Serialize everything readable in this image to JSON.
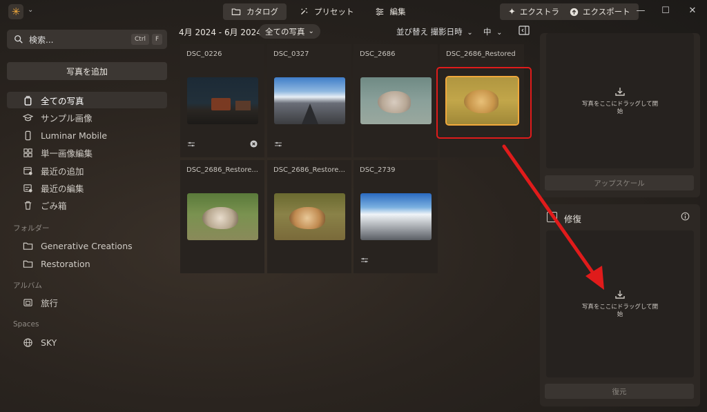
{
  "topbar": {
    "nav": [
      {
        "label": "カタログ",
        "icon": "folder-icon",
        "active": true
      },
      {
        "label": "プリセット",
        "icon": "magic-wand-icon",
        "active": false
      },
      {
        "label": "編集",
        "icon": "sliders-icon",
        "active": false
      }
    ],
    "extra_label": "エクストラ",
    "export_label": "エクスポート"
  },
  "sidebar": {
    "search_placeholder": "検索...",
    "shortcut_ctrl": "Ctrl",
    "shortcut_key": "F",
    "add_photos_label": "写真を追加",
    "items": [
      {
        "label": "全ての写真",
        "icon": "all-photos-icon",
        "active": true
      },
      {
        "label": "サンプル画像",
        "icon": "graduation-cap-icon"
      },
      {
        "label": "Luminar Mobile",
        "icon": "mobile-icon"
      },
      {
        "label": "単一画像編集",
        "icon": "grid-icon"
      },
      {
        "label": "最近の追加",
        "icon": "calendar-add-icon"
      },
      {
        "label": "最近の編集",
        "icon": "calendar-edit-icon"
      },
      {
        "label": "ごみ箱",
        "icon": "trash-icon"
      }
    ],
    "folders_label": "フォルダー",
    "folders": [
      {
        "label": "Generative Creations",
        "icon": "folder-icon"
      },
      {
        "label": "Restoration",
        "icon": "folder-icon"
      }
    ],
    "albums_label": "アルバム",
    "albums": [
      {
        "label": "旅行",
        "icon": "album-icon"
      }
    ],
    "spaces_label": "Spaces",
    "spaces": [
      {
        "label": "SKY",
        "icon": "globe-icon"
      }
    ]
  },
  "gallery": {
    "date_range": "4月 2024 - 6月 2024",
    "filter_label": "全ての写真",
    "sort_label": "並び替え 撮影日時",
    "size_label": "中",
    "photos": [
      {
        "name": "DSC_0226",
        "thumb": "night-tractor",
        "edited": true,
        "rejected": true
      },
      {
        "name": "DSC_0327",
        "thumb": "road-sky",
        "edited": true
      },
      {
        "name": "DSC_2686",
        "thumb": "leopard-faded",
        "edited": false
      },
      {
        "name": "DSC_2686_Restored",
        "thumb": "leopard-restored",
        "edited": false,
        "selected": true
      },
      {
        "name": "DSC_2686_Restore...",
        "thumb": "leopard-green",
        "edited": false
      },
      {
        "name": "DSC_2686_Restore...",
        "thumb": "leopard-warm",
        "edited": false
      },
      {
        "name": "DSC_2739",
        "thumb": "snow-sky",
        "edited": true
      }
    ]
  },
  "right_panel": {
    "upscale": {
      "drop_text_1": "写真をここにドラッグして開",
      "drop_text_2": "始",
      "button_label": "アップスケール"
    },
    "restore": {
      "title": "修復",
      "drop_text_1": "写真をここにドラッグして開",
      "drop_text_2": "始",
      "button_label": "復元"
    }
  },
  "colors": {
    "accent": "#f2a93b",
    "highlight": "#e01b1b",
    "panel": "#2d2824"
  }
}
